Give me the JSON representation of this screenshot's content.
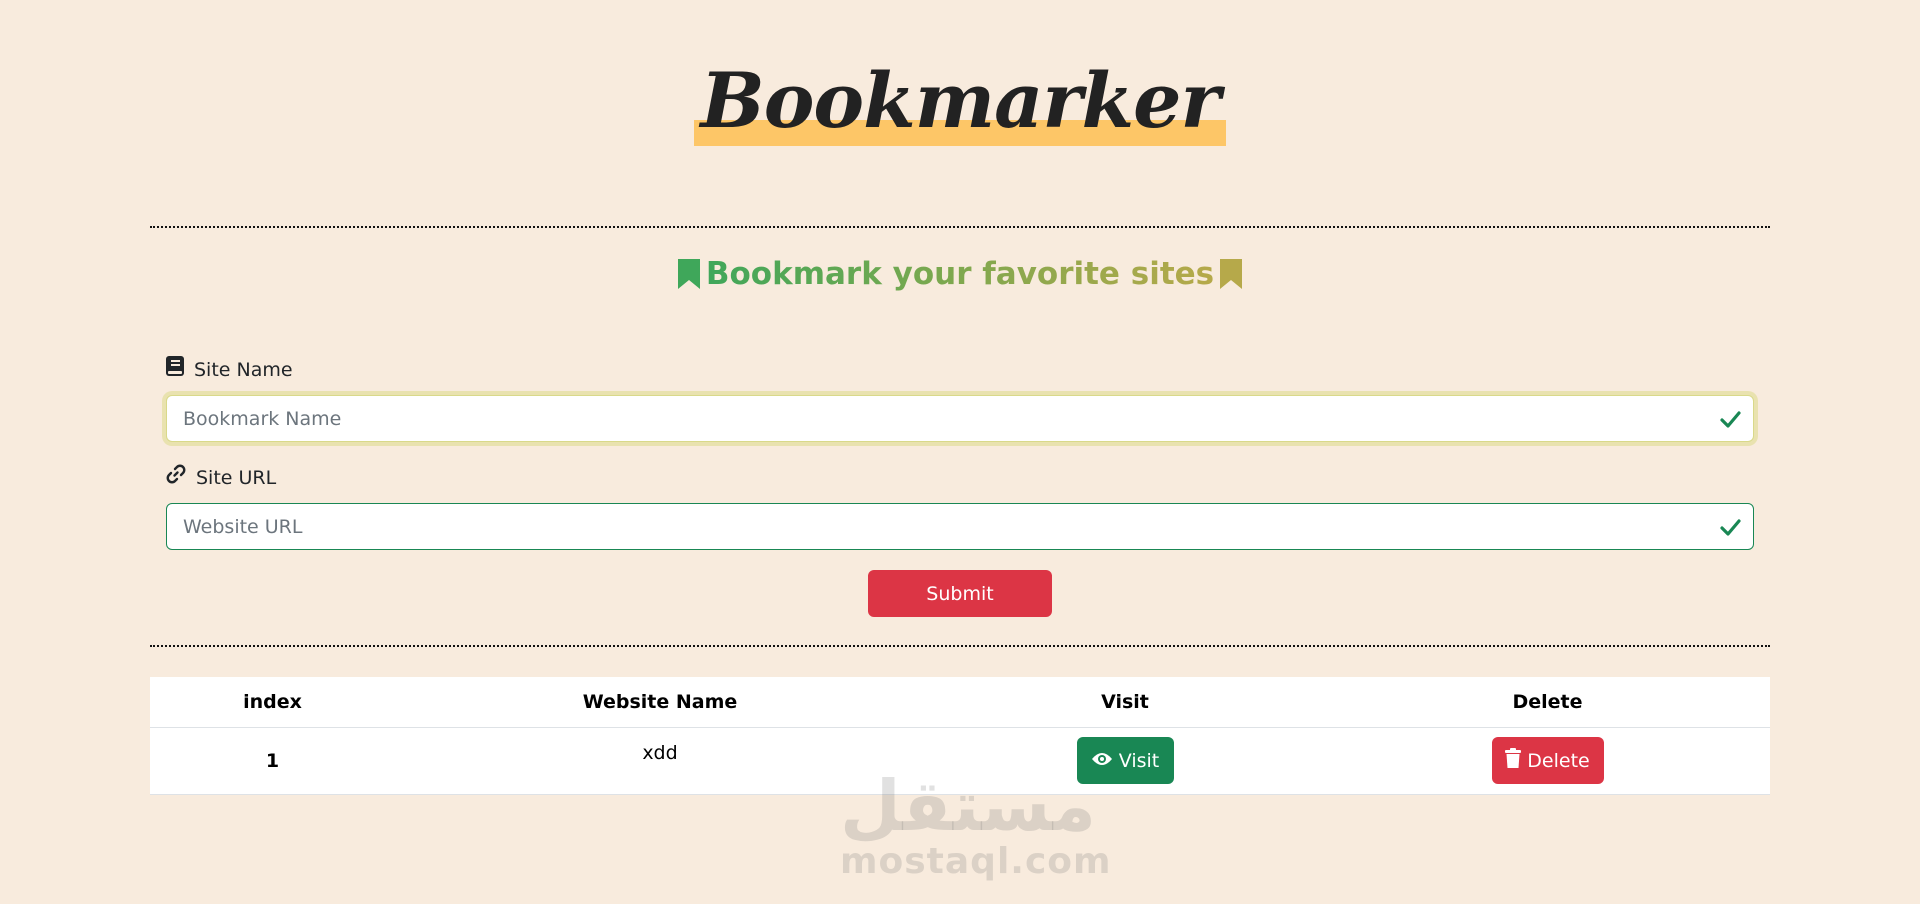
{
  "header": {
    "title": "Bookmarker"
  },
  "subtitle": {
    "text": "Bookmark your favorite sites"
  },
  "form": {
    "site_name": {
      "label": "Site Name",
      "placeholder": "Bookmark Name",
      "value": ""
    },
    "site_url": {
      "label": "Site URL",
      "placeholder": "Website URL",
      "value": ""
    },
    "submit_label": "Submit"
  },
  "table": {
    "headers": [
      "index",
      "Website Name",
      "Visit",
      "Delete"
    ],
    "rows": [
      {
        "index": "1",
        "name": "xdd",
        "visit_label": "Visit",
        "delete_label": "Delete"
      }
    ]
  },
  "watermark": {
    "arabic": "مستقل",
    "latin": "mostaql.com"
  },
  "colors": {
    "background": "#f8ebdd",
    "highlight": "#fdc667",
    "success": "#198754",
    "danger": "#dc3545",
    "bookmark_green": "#3fa75a",
    "bookmark_olive": "#b6a94a"
  }
}
